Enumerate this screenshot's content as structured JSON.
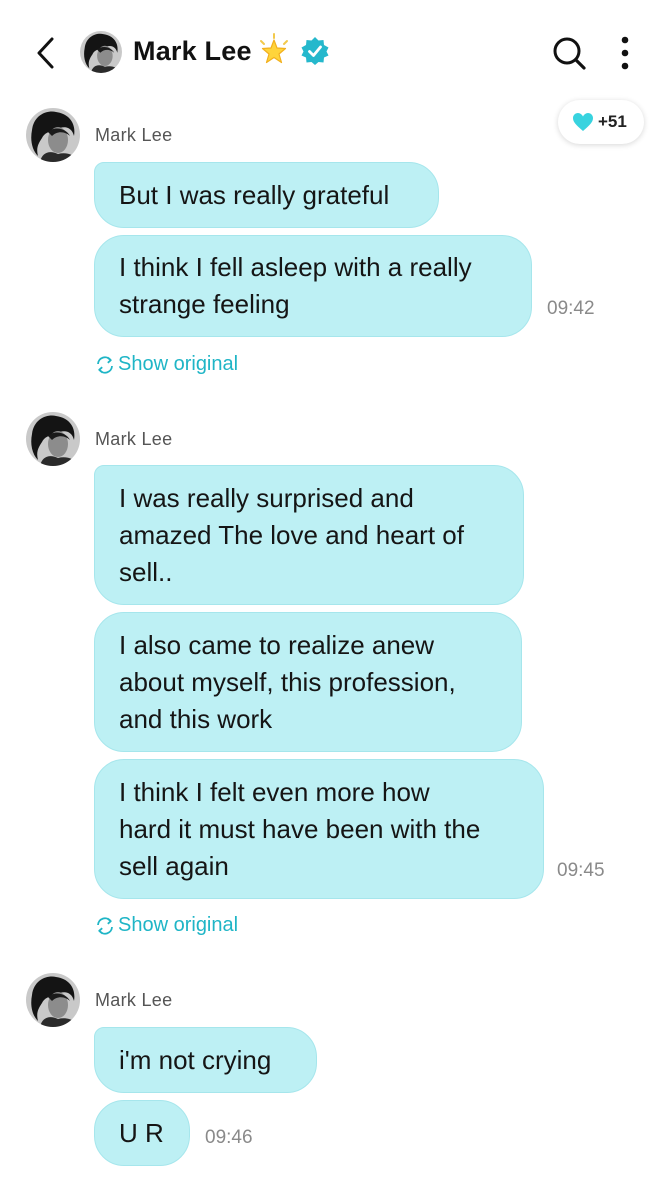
{
  "header": {
    "name": "Mark Lee",
    "back_icon": "chevron-left-icon",
    "star_icon": "star-icon",
    "verified_icon": "verified-badge-icon",
    "search_icon": "search-icon",
    "more_icon": "more-vertical-icon"
  },
  "like_badge": {
    "icon": "heart-icon",
    "count": "+51"
  },
  "colors": {
    "bubble": "#bdf0f4",
    "accent": "#1fb5c6",
    "verified": "#25b8cc",
    "time": "#8a8a8a"
  },
  "groups": [
    {
      "sender": "Mark Lee",
      "messages": [
        "But I was really grateful",
        "I think I fell asleep with a really\nstrange feeling"
      ],
      "time": "09:42",
      "show_original": "Show original"
    },
    {
      "sender": "Mark Lee",
      "messages": [
        "I was really surprised and\namazed The love and heart of\nsell..",
        "I also came to realize anew\nabout myself, this profession,\nand this work",
        "I think I felt even more how\nhard it must have been with the\nsell again"
      ],
      "time": "09:45",
      "show_original": "Show original"
    },
    {
      "sender": "Mark Lee",
      "messages": [
        "i'm not crying",
        "U R"
      ],
      "time": "09:46"
    }
  ]
}
